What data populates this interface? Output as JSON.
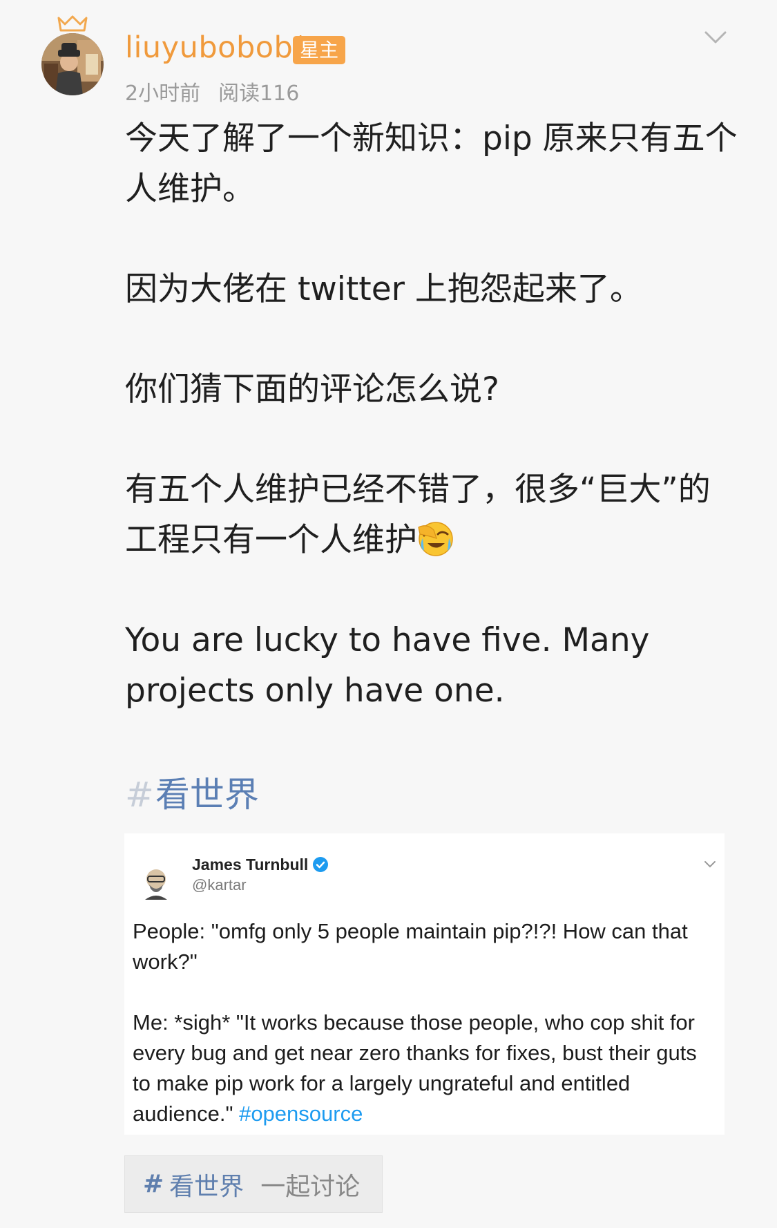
{
  "post": {
    "author": {
      "name": "liuyubobob*",
      "badge": "星主"
    },
    "meta": {
      "time": "2小时前",
      "reads": "阅读116"
    },
    "paragraphs": [
      "今天了解了一个新知识：pip 原来只有五个人维护。",
      "因为大佬在 twitter 上抱怨起来了。",
      "你们猜下面的评论怎么说?",
      "有五个人维护已经不错了，很多“巨大”的工程只有一个人维护",
      "You are lucky to have five. Many projects only have one."
    ],
    "emoji": "facepalm-crying-emoji",
    "topic": "看世界"
  },
  "tweet": {
    "author": "James Turnbull",
    "handle": "@kartar",
    "line1": "People: \"omfg only 5 people maintain pip?!?! How can that work?\"",
    "line2": "Me: *sigh* \"It works because those people, who cop shit for every bug and get near zero thanks for fixes, bust their guts to make pip work for a largely ungrateful and entitled audience.\"",
    "hashtag": "#opensource"
  },
  "topic_chip": {
    "hash": "#",
    "topic": "看世界",
    "action": "一起讨论"
  },
  "colors": {
    "username": "#f09a3c",
    "badge": "#f7a54a",
    "topic": "#5b7fb4",
    "twitter_link": "#1d9bf0"
  }
}
